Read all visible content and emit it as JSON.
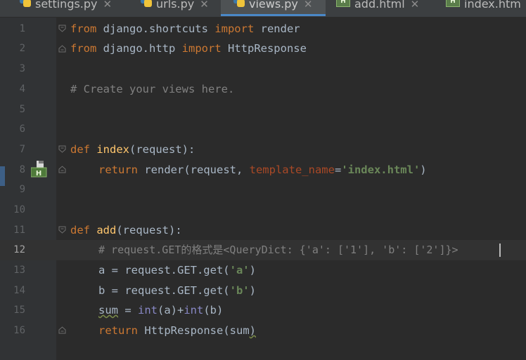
{
  "tabs": [
    {
      "name": "settings.py",
      "type": "py",
      "active": false
    },
    {
      "name": "urls.py",
      "type": "py",
      "active": false
    },
    {
      "name": "views.py",
      "type": "py",
      "active": true
    },
    {
      "name": "add.html",
      "type": "html",
      "active": false
    },
    {
      "name": "index.htm",
      "type": "html",
      "active": false
    }
  ],
  "tab_close_glyph": "✕",
  "html_icon_letter": "H",
  "line_numbers": [
    "1",
    "2",
    "3",
    "4",
    "5",
    "6",
    "7",
    "8",
    "9",
    "10",
    "11",
    "12",
    "13",
    "14",
    "15",
    "16"
  ],
  "current_line": "12",
  "code": {
    "l1": {
      "kw1": "from",
      "mod": " django.shortcuts ",
      "kw2": "import",
      "name": " render"
    },
    "l2": {
      "kw1": "from",
      "mod": " django.http ",
      "kw2": "import",
      "name": " HttpResponse"
    },
    "l4": {
      "comment": "# Create your views here."
    },
    "l7": {
      "kw": "def",
      "sp": " ",
      "fn": "index",
      "rest": "(request):"
    },
    "l8": {
      "kw": "return",
      "a": " render(request, ",
      "param": "template_name",
      "eq": "=",
      "str": "'index.html'",
      "close": ")"
    },
    "l11": {
      "kw": "def",
      "sp": " ",
      "fn": "add",
      "rest": "(request):"
    },
    "l12": {
      "comment": "# request.GET的格式是<QueryDict: {'a': ['1'], 'b': ['2']}>"
    },
    "l13": {
      "a": "a = request.GET.get(",
      "str": "'a'",
      "close": ")"
    },
    "l14": {
      "a": "b = request.GET.get(",
      "str": "'b'",
      "close": ")"
    },
    "l15": {
      "var": "sum",
      "eq": " = ",
      "b1": "int",
      "a": "(a)+",
      "b2": "int",
      "b": "(b)"
    },
    "l16": {
      "kw": "return",
      "a": " HttpResponse(",
      "var": "sum",
      "close": ")"
    }
  },
  "colors": {
    "background": "#2b2b2b",
    "keyword": "#cc7832",
    "function": "#ffc66d",
    "string": "#6a8759",
    "comment": "#808080",
    "param": "#aa4926",
    "builtin": "#8888c6",
    "tab_accent": "#4a88c7"
  },
  "icons": {
    "python_file": "python-file-icon",
    "html_file": "html-file-icon",
    "fold": "fold-marker-icon",
    "gutter_run": "related-template-icon"
  }
}
